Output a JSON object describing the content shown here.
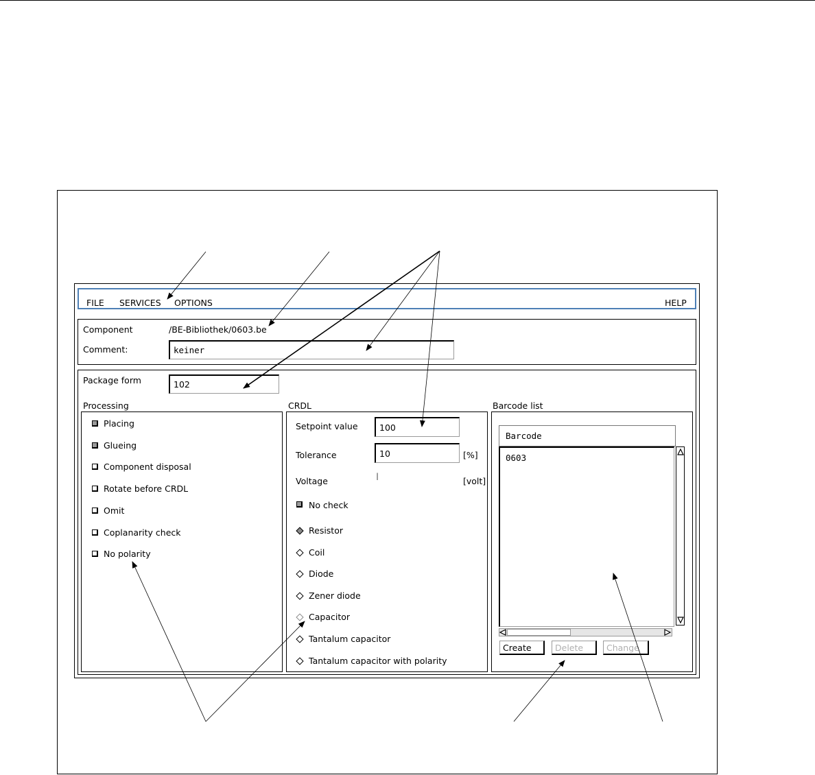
{
  "menu": {
    "file": "FILE",
    "services": "SERVICES",
    "options": "OPTIONS",
    "help": "HELP"
  },
  "component": {
    "label": "Component",
    "value": "/BE-Bibliothek/0603.be",
    "comment_label": "Comment:",
    "comment_value": "keiner"
  },
  "package": {
    "label": "Package form",
    "value": "102"
  },
  "processing": {
    "title": "Processing",
    "items": [
      {
        "label": "Placing",
        "checked": true
      },
      {
        "label": "Glueing",
        "checked": true
      },
      {
        "label": "Component disposal",
        "checked": false
      },
      {
        "label": "Rotate before CRDL",
        "checked": false
      },
      {
        "label": "Omit",
        "checked": false
      },
      {
        "label": "Coplanarity check",
        "checked": false
      },
      {
        "label": "No polarity",
        "checked": false
      }
    ]
  },
  "crdl": {
    "title": "CRDL",
    "setpoint_label": "Setpoint value",
    "setpoint_value": "100",
    "tolerance_label": "Tolerance",
    "tolerance_value": "10",
    "tolerance_unit": "[%]",
    "voltage_label": "Voltage",
    "voltage_unit": "[volt]",
    "nocheck_label": "No check",
    "types": [
      {
        "label": "Resistor",
        "selected": true
      },
      {
        "label": "Coil",
        "selected": false
      },
      {
        "label": "Diode",
        "selected": false
      },
      {
        "label": "Zener diode",
        "selected": false
      },
      {
        "label": "Capacitor",
        "selected": false
      },
      {
        "label": "Tantalum capacitor",
        "selected": false
      },
      {
        "label": "Tantalum capacitor with polarity",
        "selected": false
      }
    ]
  },
  "barcode": {
    "title": "Barcode list",
    "column": "Barcode",
    "rows": [
      "0603"
    ],
    "create": "Create",
    "delete": "Delete",
    "change": "Change"
  }
}
